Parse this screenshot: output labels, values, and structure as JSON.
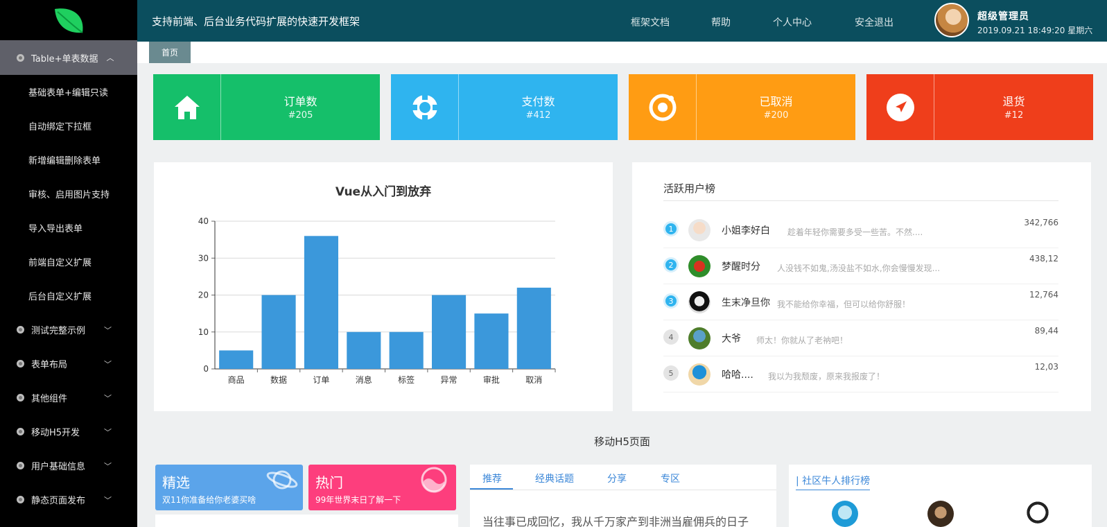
{
  "colors": {
    "sidebar_bg": "#000000",
    "header_bg": "#0b4e5e",
    "green": "#15bf6a",
    "blue": "#2fb4ef",
    "orange": "#ff9c13",
    "red": "#ef3e1b",
    "bar": "#3b98db"
  },
  "sidebar": {
    "logo_icon": "leaf-icon",
    "open_group": {
      "label": "Table+单表数据",
      "icon": "chevron-up-icon"
    },
    "sub_items": [
      "基础表单+编辑只读",
      "自动绑定下拉框",
      "新增编辑删除表单",
      "审核、启用图片支持",
      "导入导出表单",
      "前端自定义扩展",
      "后台自定义扩展"
    ],
    "groups": [
      "测试完整示例",
      "表单布局",
      "其他组件",
      "移动H5开发",
      "用户基础信息",
      "静态页面发布"
    ]
  },
  "header": {
    "slogan": "支持前端、后台业务代码扩展的快速开发框架",
    "nav": [
      "框架文档",
      "帮助",
      "个人中心",
      "安全退出"
    ],
    "user_name": "超级管理员",
    "datetime": "2019.09.21 18:49:20 星期六"
  },
  "tabs": {
    "home": "首页"
  },
  "stats": [
    {
      "label": "订单数",
      "value": "#205",
      "icon": "home-icon"
    },
    {
      "label": "支付数",
      "value": "#412",
      "icon": "lifebuoy-icon"
    },
    {
      "label": "已取消",
      "value": "#200",
      "icon": "target-icon"
    },
    {
      "label": "退货",
      "value": "#12",
      "icon": "navigate-icon"
    }
  ],
  "chart_data": {
    "type": "bar",
    "title": "Vue从入门到放弃",
    "categories": [
      "商品",
      "数据",
      "订单",
      "消息",
      "标签",
      "异常",
      "审批",
      "取消"
    ],
    "values": [
      5,
      20,
      36,
      10,
      10,
      20,
      15,
      22
    ],
    "yticks": [
      0,
      10,
      20,
      30,
      40
    ],
    "ylim": [
      0,
      40
    ],
    "grid": true
  },
  "ranking": {
    "title": "活跃用户榜",
    "rows": [
      {
        "rank": "1",
        "name": "小姐李好白",
        "desc": "趁着年轻你需要多受一些苦。不然....",
        "score": "342,766"
      },
      {
        "rank": "2",
        "name": "梦醒时分",
        "desc": "人没钱不如鬼,汤没盐不如水,你会慢慢发现...",
        "score": "438,12"
      },
      {
        "rank": "3",
        "name": "生末净旦你",
        "desc": "我不能给你幸福，但可以给你舒服！",
        "score": "12,764"
      },
      {
        "rank": "4",
        "name": "大爷",
        "desc": "师太！你就从了老衲吧！",
        "score": "89,44"
      },
      {
        "rank": "5",
        "name": "哈哈....",
        "desc": "我以为我颓废，原来我报废了！",
        "score": "12,03"
      }
    ]
  },
  "mobile": {
    "section_title": "移动H5页面",
    "promos": [
      {
        "title": "精选",
        "sub": "双11你准备给你老婆买啥",
        "icon": "planet-icon"
      },
      {
        "title": "热门",
        "sub": "99年世界末日了解一下",
        "icon": "wave-circle-icon"
      }
    ],
    "tabs": [
      "推荐",
      "经典话题",
      "分享",
      "专区"
    ],
    "article": "当往事已成回忆，我从千万家产到非洲当雇佣兵的日子",
    "community_title": "| 社区牛人排行榜"
  }
}
